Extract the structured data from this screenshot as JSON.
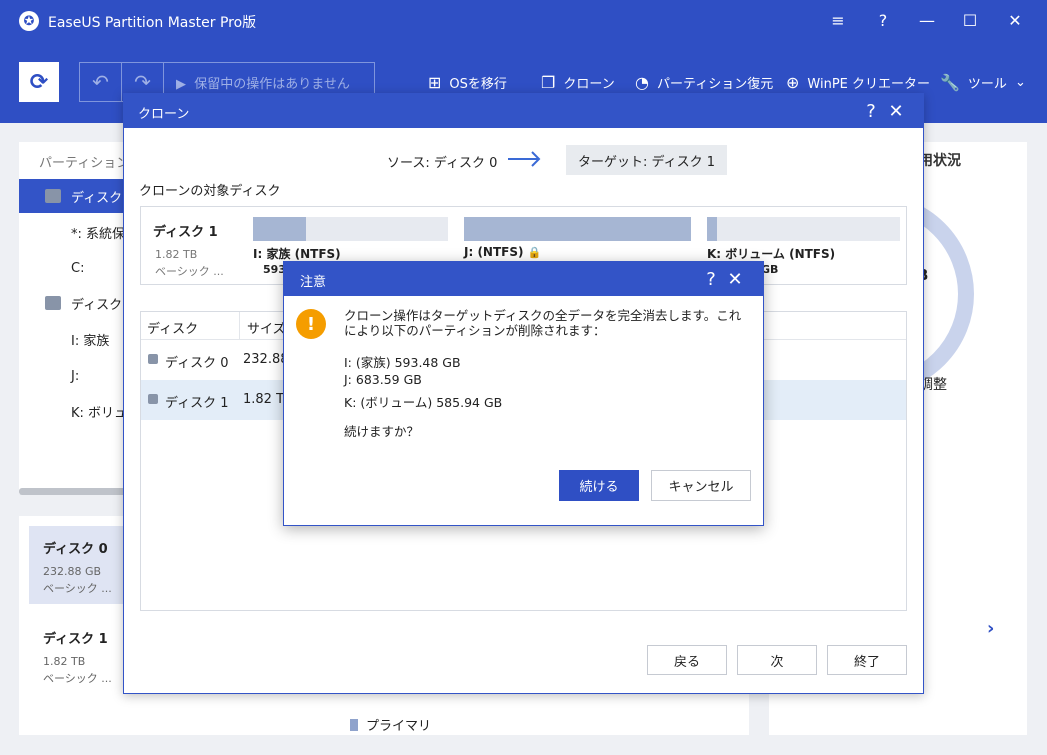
{
  "app": {
    "title": "EaseUS Partition Master Pro版",
    "controls": {
      "menu": "≡",
      "help": "?",
      "minimize": "—",
      "maximize": "☐",
      "close": "✕"
    }
  },
  "toolbar": {
    "pending_ops": "保留中の操作はありません",
    "tools": [
      {
        "label": "OSを移行",
        "icon": "windows-icon"
      },
      {
        "label": "クローン",
        "icon": "clone-icon"
      },
      {
        "label": "パーティション復元",
        "icon": "pie-restore-icon"
      },
      {
        "label": "WinPE クリエーター",
        "icon": "plus-circle-icon"
      },
      {
        "label": "ツール",
        "icon": "wrench-icon"
      }
    ]
  },
  "left_panel": {
    "header": "パーティション",
    "tree": [
      {
        "label": "ディスク 0",
        "kind": "disk",
        "selected": true
      },
      {
        "label": "*: 系統保",
        "kind": "partition"
      },
      {
        "label": "C:",
        "kind": "partition"
      },
      {
        "label": "ディスク 1",
        "kind": "disk"
      },
      {
        "label": "I: 家族",
        "kind": "partition"
      },
      {
        "label": "J:",
        "kind": "partition"
      },
      {
        "label": "K: ボリュー",
        "kind": "partition"
      }
    ]
  },
  "disk_cards": [
    {
      "name": "ディスク 0",
      "size": "232.88 GB",
      "type": "ベーシック ...",
      "selected": true
    },
    {
      "name": "ディスク 1",
      "size": "1.82 TB",
      "type": "ベーシック ..."
    }
  ],
  "legend": {
    "primary": "プライマリ"
  },
  "right_panel": {
    "title": "用状況",
    "donut_label": "B",
    "adjust_label": "調整"
  },
  "clone_dialog": {
    "title": "クローン",
    "source": "ソース: ディスク 0",
    "target": "ターゲット: ディスク 1",
    "target_section_title": "クローンの対象ディスク",
    "disk": {
      "name": "ディスク 1",
      "size": "1.82 TB",
      "type": "ベーシック ...",
      "partitions": [
        {
          "label": "I: 家族 (NTFS)",
          "size": "593",
          "fill": 0.27
        },
        {
          "label": "J: (NTFS)",
          "size": "",
          "fill": 1.0,
          "locked": true
        },
        {
          "label": "K: ボリューム (NTFS)",
          "size": "GB",
          "fill": 0.05
        }
      ]
    },
    "table": {
      "headers": [
        "ディスク",
        "サイズ"
      ],
      "rows": [
        {
          "disk": "ディスク 0",
          "size": "232.88"
        },
        {
          "disk": "ディスク 1",
          "size": "1.82 TB",
          "selected": true
        }
      ]
    },
    "buttons": {
      "back": "戻る",
      "next": "次",
      "finish": "終了"
    }
  },
  "warning_dialog": {
    "title": "注意",
    "message": "クローン操作はターゲットディスクの全データを完全消去します。これにより以下のパーティションが削除されます：",
    "items": [
      "I: (家族) 593.48 GB",
      "J: 683.59 GB",
      "K: (ボリューム) 585.94 GB"
    ],
    "question": "続けますか？",
    "buttons": {
      "continue": "続ける",
      "cancel": "キャンセル"
    }
  },
  "colors": {
    "accent": "#2f4fc4",
    "warning": "#f59d00",
    "selected_row": "#e3edf8"
  }
}
